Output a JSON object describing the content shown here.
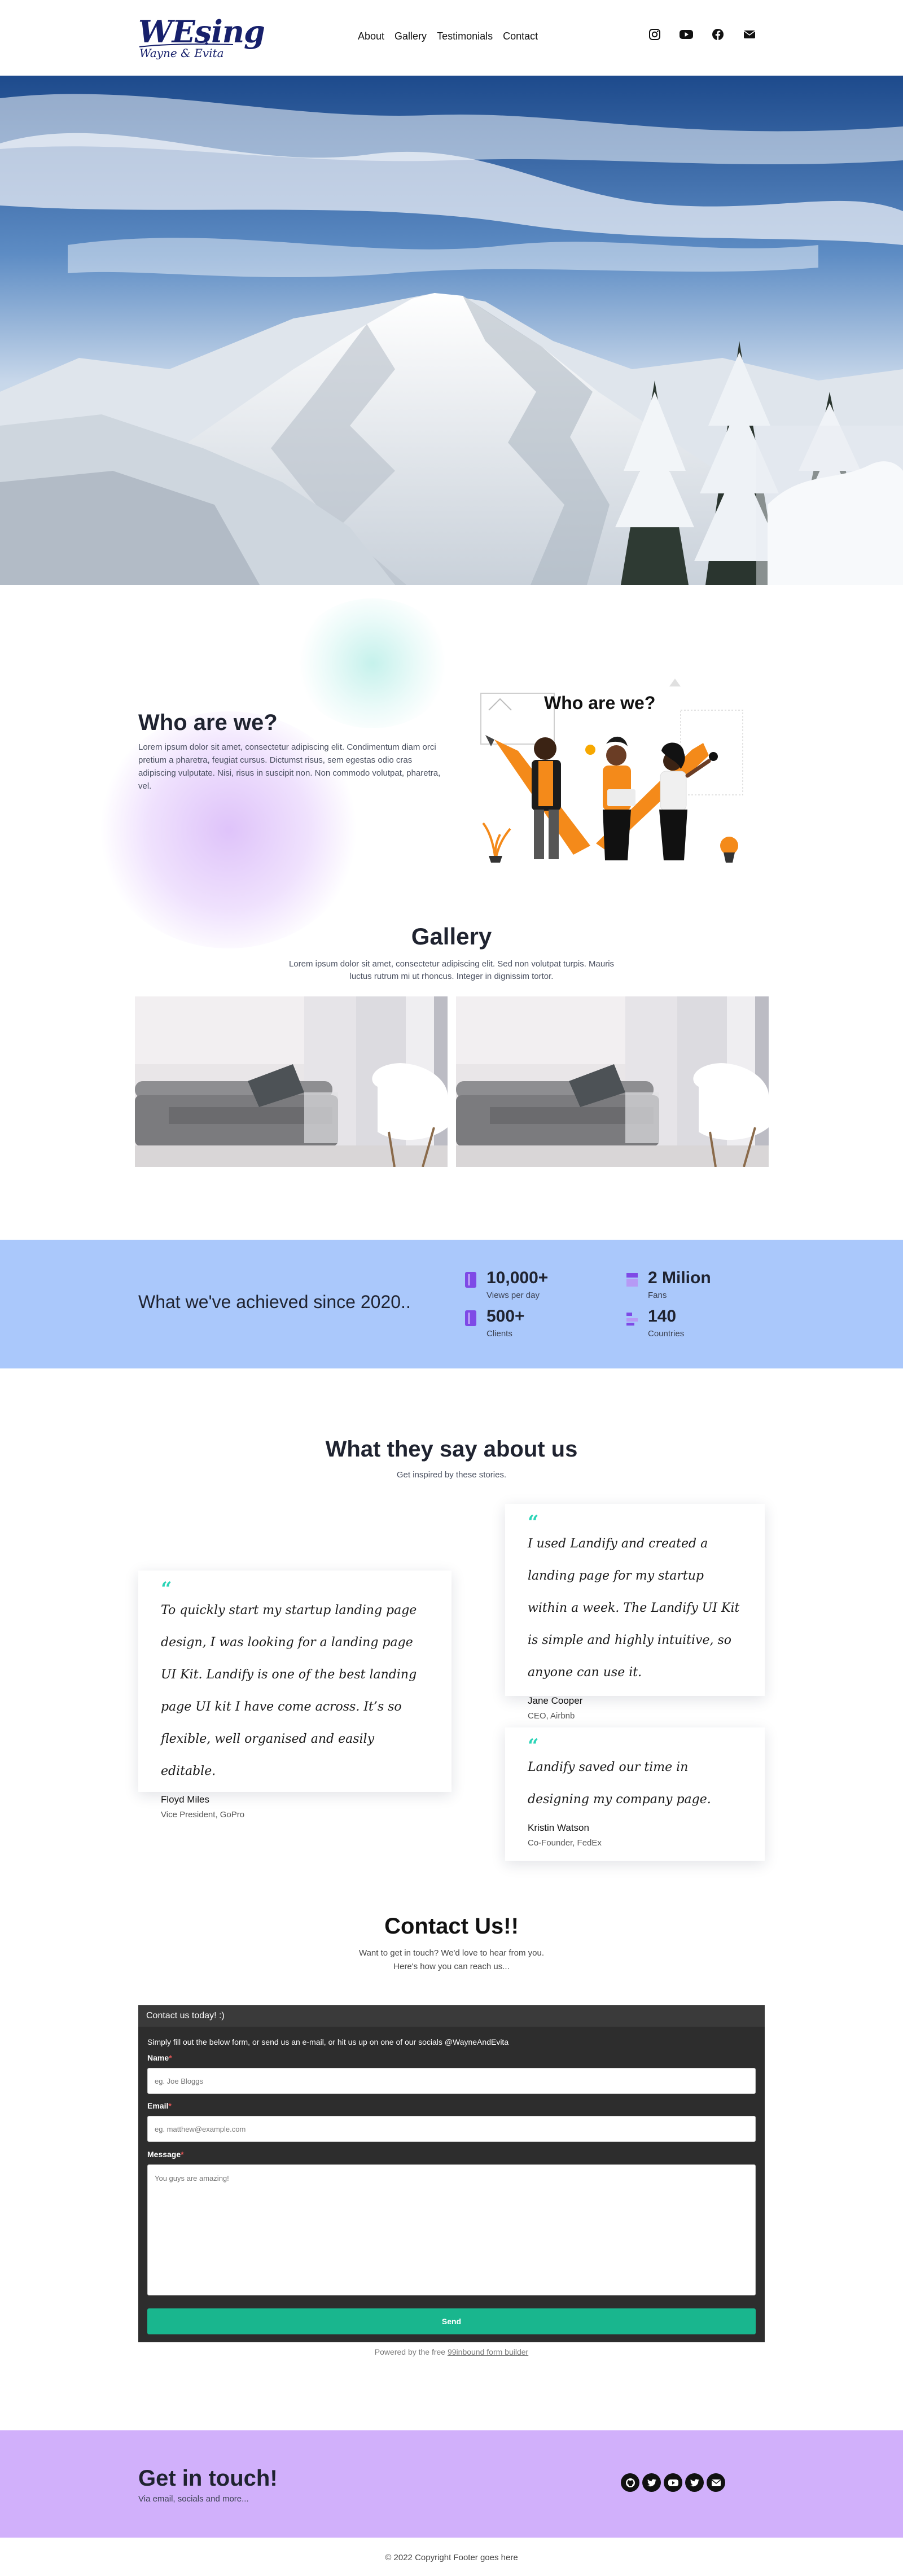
{
  "nav": {
    "logo_big": "WEsing",
    "logo_small": "Wayne & Evita",
    "links": [
      "About",
      "Gallery",
      "Testimonials",
      "Contact"
    ],
    "social_icons": [
      "instagram-icon",
      "youtube-icon",
      "facebook-icon",
      "email-icon"
    ]
  },
  "who": {
    "title": "Who are we?",
    "text": "Lorem ipsum dolor sit amet, consectetur adipiscing elit. Condimentum diam orci pretium a pharetra, feugiat cursus. Dictumst risus, sem egestas odio cras adipiscing vulputate. Nisi, risus in suscipit non. Non commodo volutpat, pharetra, vel.",
    "illustration_heading": "Who are we?"
  },
  "gallery": {
    "title": "Gallery",
    "subtitle": "Lorem ipsum dolor sit amet, consectetur adipiscing elit. Sed non volutpat turpis. Mauris luctus rutrum mi ut rhoncus. Integer in dignissim tortor."
  },
  "stats": {
    "title": "What we've achieved since 2020..",
    "items": [
      {
        "value": "10,000+",
        "label": "Views per day",
        "color": "#8a4be8"
      },
      {
        "value": "2 Milion",
        "label": "Fans",
        "color": "#8a4be8"
      },
      {
        "value": "500+",
        "label": "Clients",
        "color": "#8a4be8"
      },
      {
        "value": "140",
        "label": "Countries",
        "color": "#8a4be8"
      }
    ]
  },
  "testimonials": {
    "title": "What they say about us",
    "subtitle": "Get inspired by these stories.",
    "quote_mark": "“",
    "items": [
      {
        "text": "To quickly start my startup landing page design, I was looking for a landing page UI Kit. Landify is one of the best landing page UI kit I have come across. It’s so flexible, well organised and easily editable.",
        "name": "Floyd Miles",
        "role": "Vice President, GoPro"
      },
      {
        "text": "I used Landify and created a landing page for my startup within a week. The Landify UI Kit is simple and highly intuitive, so anyone can use it.",
        "name": "Jane Cooper",
        "role": "CEO, Airbnb"
      },
      {
        "text": "Landify saved our time in designing my company page.",
        "name": "Kristin Watson",
        "role": "Co-Founder, FedEx"
      }
    ]
  },
  "contact": {
    "title": "Contact Us!!",
    "subtitle_line1": "Want to get in touch? We'd love to hear from you.",
    "subtitle_line2": "Here's how you can reach us...",
    "form_header": "Contact us today! :)",
    "form_intro": "Simply fill out the below form, or send us an e-mail, or hit us up on one of our socials @WayneAndEvita",
    "name_label": "Name",
    "name_placeholder": "eg. Joe Bloggs",
    "email_label": "Email",
    "email_placeholder": "eg. matthew@example.com",
    "message_label": "Message",
    "message_placeholder": "You guys are amazing!",
    "required_mark": "*",
    "send_label": "Send",
    "powered_prefix": "Powered by the free ",
    "powered_link": "99inbound form builder"
  },
  "footer": {
    "title": "Get in touch!",
    "subtitle": "Via email, socials and more...",
    "icons": [
      "github-icon",
      "twitter-icon",
      "youtube-icon",
      "twitter-icon",
      "email-icon"
    ],
    "copyright": "© 2022 Copyright Footer goes here"
  }
}
